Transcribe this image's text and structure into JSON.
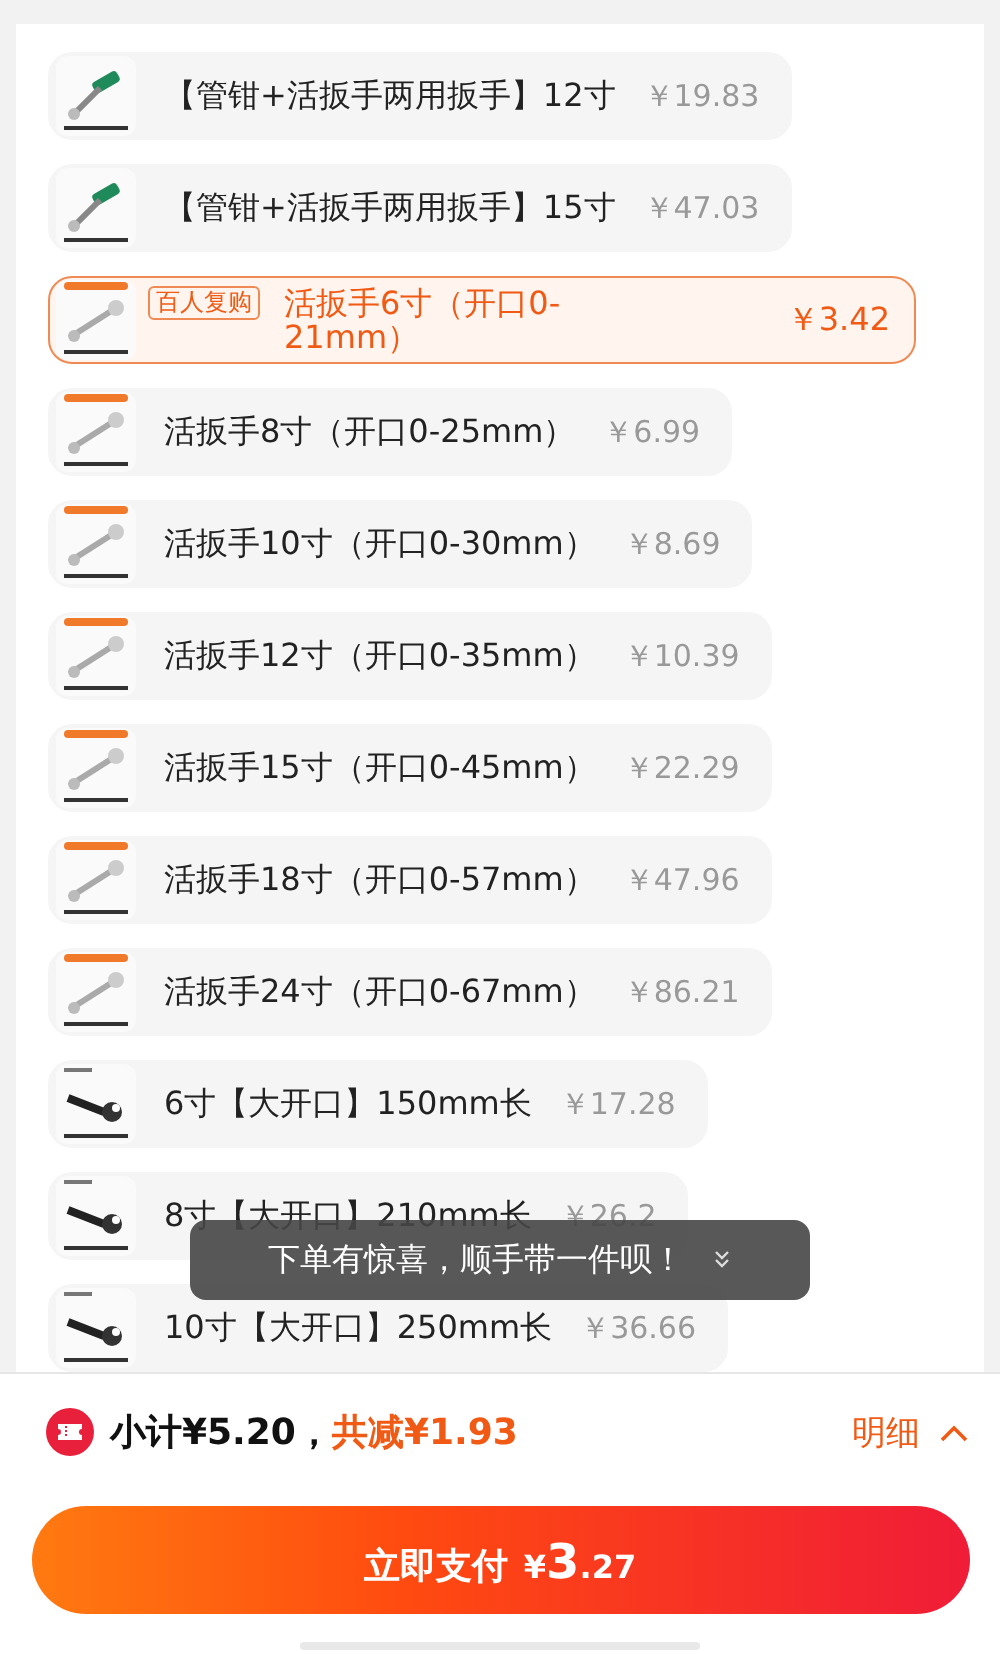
{
  "items": [
    {
      "name": "【管钳+活扳手两用扳手】12寸",
      "price": "￥19.83",
      "selected": false
    },
    {
      "name": "【管钳+活扳手两用扳手】15寸",
      "price": "￥47.03",
      "selected": false
    },
    {
      "name": "活扳手6寸（开口0-21mm）",
      "price": "￥3.42",
      "selected": true,
      "tag": "百人复购"
    },
    {
      "name": "活扳手8寸（开口0-25mm）",
      "price": "￥6.99",
      "selected": false
    },
    {
      "name": "活扳手10寸（开口0-30mm）",
      "price": "￥8.69",
      "selected": false
    },
    {
      "name": "活扳手12寸（开口0-35mm）",
      "price": "￥10.39",
      "selected": false
    },
    {
      "name": "活扳手15寸（开口0-45mm）",
      "price": "￥22.29",
      "selected": false
    },
    {
      "name": "活扳手18寸（开口0-57mm）",
      "price": "￥47.96",
      "selected": false
    },
    {
      "name": "活扳手24寸（开口0-67mm）",
      "price": "￥86.21",
      "selected": false
    },
    {
      "name": "6寸【大开口】150mm长",
      "price": "￥17.28",
      "selected": false
    },
    {
      "name": "8寸【大开口】210mm长",
      "price": "￥26.2",
      "selected": false
    },
    {
      "name": "10寸【大开口】250mm长",
      "price": "￥36.66",
      "selected": false
    }
  ],
  "toast": {
    "text": "下单有惊喜，顺手带一件呗！"
  },
  "summary": {
    "subtotal": "小计¥5.20，",
    "discount": "共减¥1.93",
    "details": "明细"
  },
  "pay_button": {
    "label": "立即支付",
    "currency": "¥",
    "amount": "3",
    "cents": ".27"
  }
}
